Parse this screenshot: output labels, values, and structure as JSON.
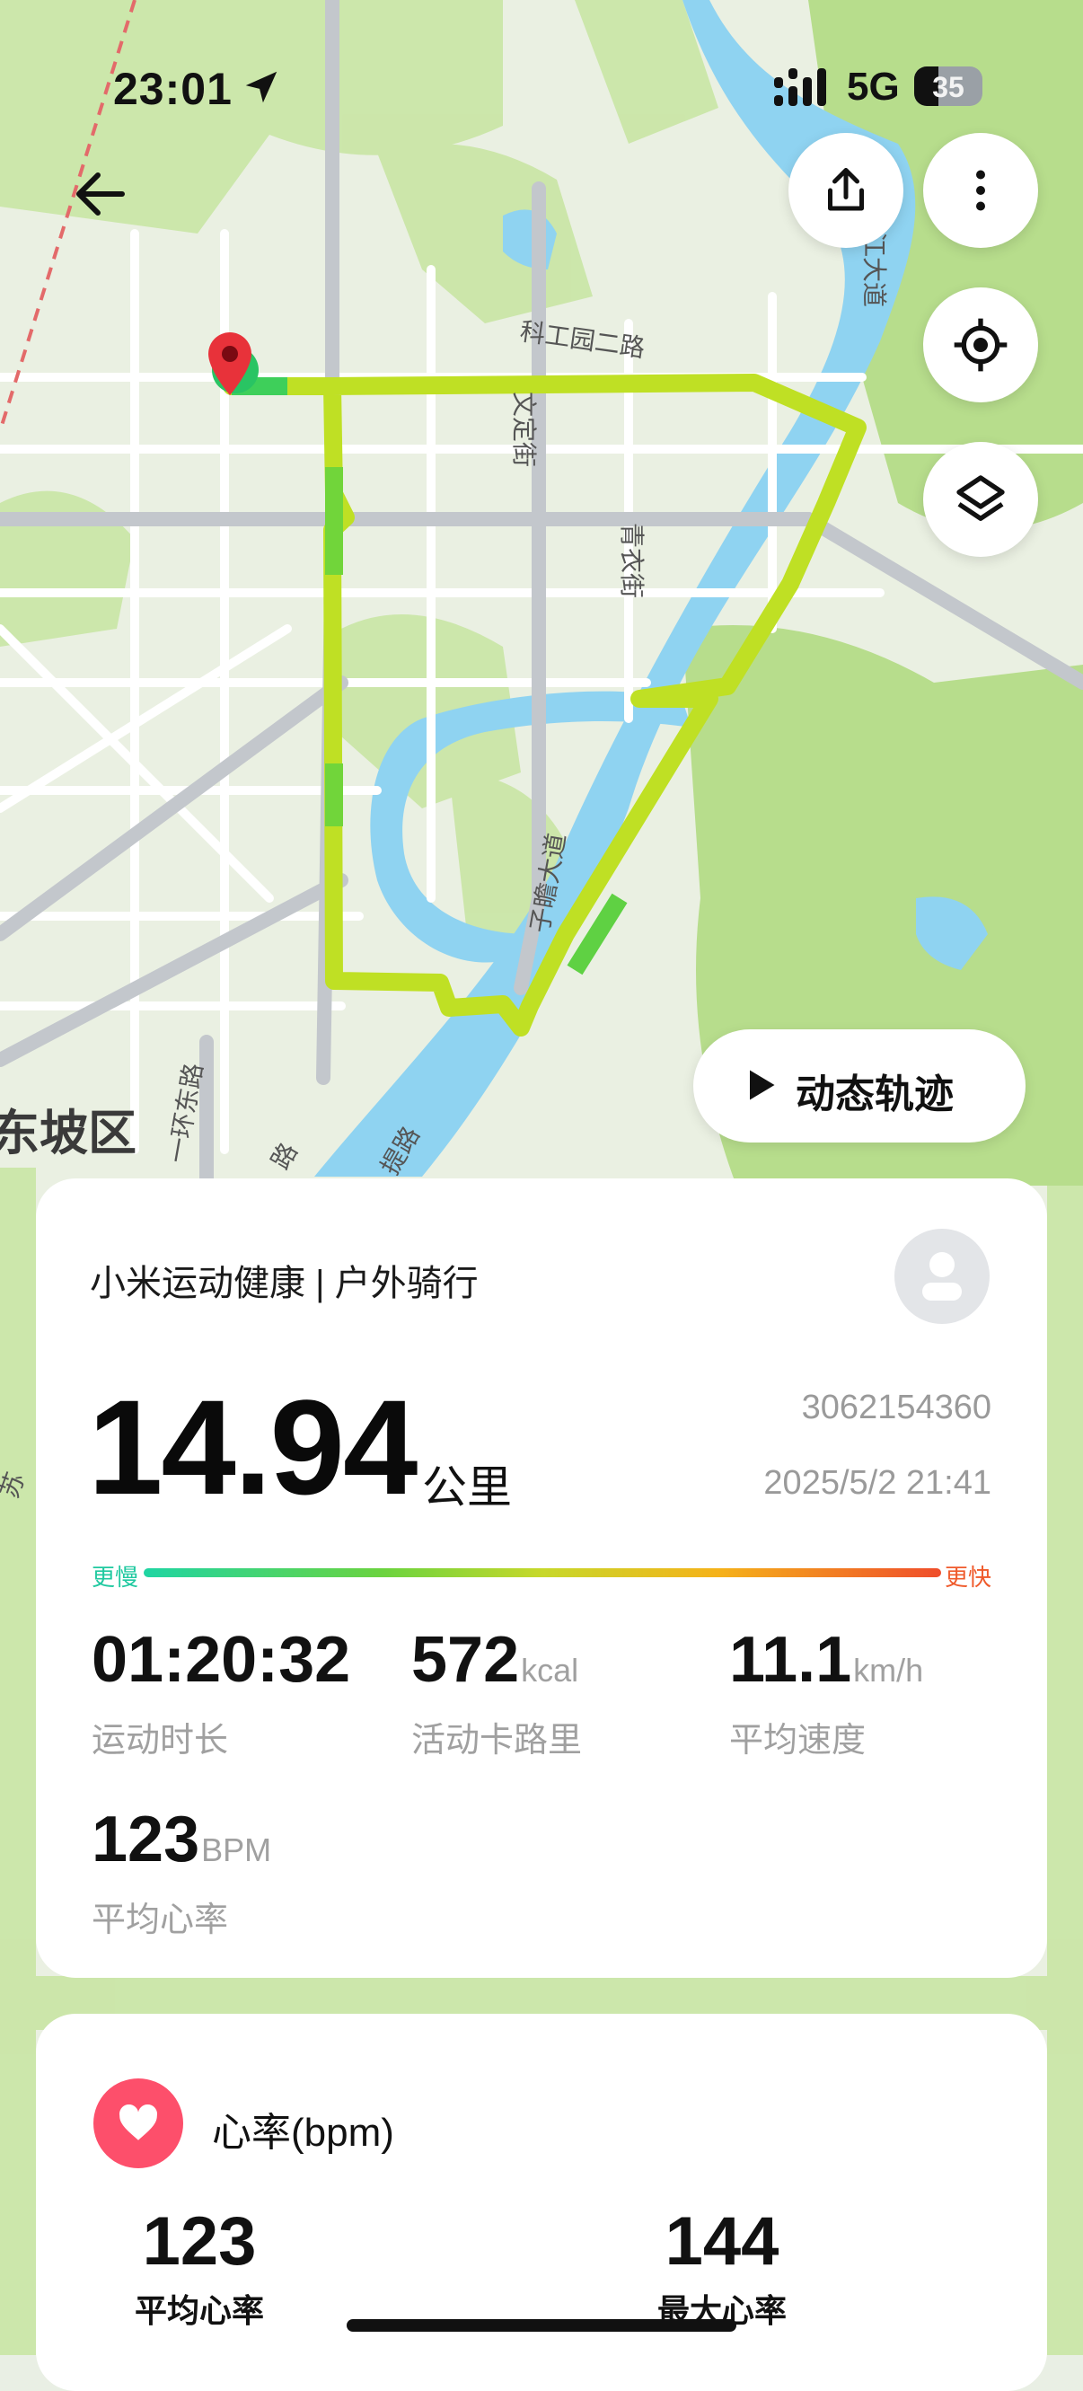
{
  "status_bar": {
    "time": "23:01",
    "network": "5G",
    "battery": "35",
    "battery_level": 0.35
  },
  "map": {
    "labels": {
      "road1": "科工园二路",
      "road2": "文定街",
      "road3": "青衣街",
      "road4": "滨江大道",
      "road5": "子瞻大道",
      "road6": "一环东路",
      "road7": "提路",
      "road8": "路",
      "district": "东坡区",
      "side": "苏"
    }
  },
  "actions": {
    "share_icon": "share-icon",
    "more_icon": "more-vertical-icon",
    "locate_icon": "locate-icon",
    "layers_icon": "layers-icon"
  },
  "play": {
    "label": "动态轨迹"
  },
  "summary": {
    "app_label": "小米运动健康 | 户外骑行",
    "distance": "14.94",
    "distance_unit": "公里",
    "record_id": "3062154360",
    "date": "2025/5/2 21:41",
    "slower": "更慢",
    "faster": "更快",
    "stats": [
      {
        "value": "01:20:32",
        "unit": "",
        "label": "运动时长"
      },
      {
        "value": "572",
        "unit": "kcal",
        "label": "活动卡路里"
      },
      {
        "value": "11.1",
        "unit": "km/h",
        "label": "平均速度"
      },
      {
        "value": "123",
        "unit": "BPM",
        "label": "平均心率"
      }
    ]
  },
  "heart_rate": {
    "title": "心率(bpm)",
    "avg_value": "123",
    "avg_label": "平均心率",
    "max_value": "144",
    "max_label": "最大心率"
  }
}
